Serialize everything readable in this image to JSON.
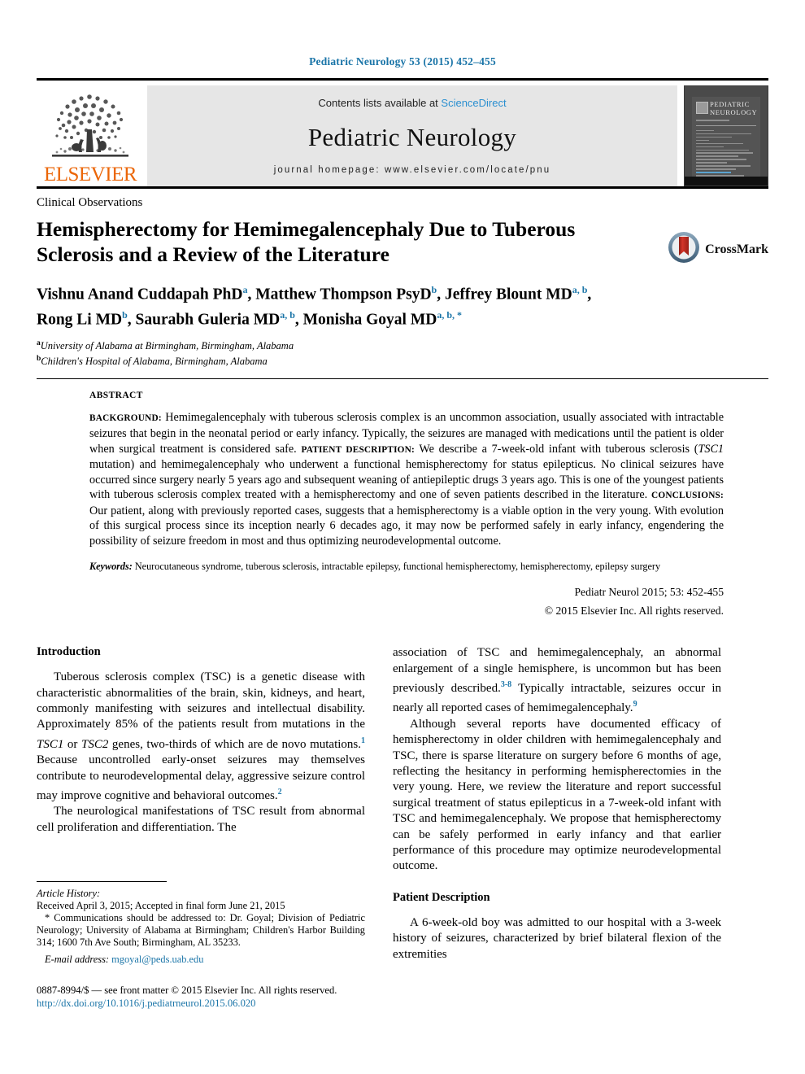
{
  "running_head": "Pediatric Neurology 53 (2015) 452–455",
  "banner": {
    "contents_prefix": "Contents lists available at ",
    "sciencedirect": "ScienceDirect",
    "journal_name": "Pediatric Neurology",
    "homepage": "journal homepage: www.elsevier.com/locate/pnu",
    "publisher_wordmark": "ELSEVIER",
    "publisher_logo_icon": "elsevier-tree-icon",
    "cover_title_line1": "PEDIATRIC",
    "cover_title_line2": "NEUROLOGY"
  },
  "article": {
    "kicker": "Clinical Observations",
    "title": "Hemispherectomy for Hemimegalencephaly Due to Tuberous Sclerosis and a Review of the Literature",
    "crossmark_label": "CrossMark",
    "crossmark_icon": "crossmark-icon",
    "authors_line1_a": "Vishnu Anand Cuddapah PhD",
    "authors_sup1": "a",
    "authors_line1_b": ", Matthew Thompson PsyD",
    "authors_sup2": "b",
    "authors_line1_c": ", Jeffrey Blount MD",
    "authors_sup3": "a, b",
    "authors_line1_d": ",",
    "authors_line2_a": "Rong Li MD",
    "authors_sup4": "b",
    "authors_line2_b": ", Saurabh Guleria MD",
    "authors_sup5": "a, b",
    "authors_line2_c": ", Monisha Goyal MD",
    "authors_sup6": "a, b, *",
    "affiliation_a_marker": "a",
    "affiliation_a": "University of Alabama at Birmingham, Birmingham, Alabama",
    "affiliation_b_marker": "b",
    "affiliation_b": "Children's Hospital of Alabama, Birmingham, Alabama"
  },
  "abstract": {
    "heading": "ABSTRACT",
    "label_background": "BACKGROUND:",
    "background_text": " Hemimegalencephaly with tuberous sclerosis complex is an uncommon association, usually associated with intractable seizures that begin in the neonatal period or early infancy. Typically, the seizures are managed with medications until the patient is older when surgical treatment is considered safe. ",
    "label_patient": "PATIENT DESCRIPTION:",
    "patient_text_pre": " We describe a 7-week-old infant with tuberous sclerosis (",
    "patient_italic": "TSC1",
    "patient_text_post": " mutation) and hemimegalencephaly who underwent a functional hemispherectomy for status epilepticus. No clinical seizures have occurred since surgery nearly 5 years ago and subsequent weaning of antiepileptic drugs 3 years ago. This is one of the youngest patients with tuberous sclerosis complex treated with a hemispherectomy and one of seven patients described in the literature. ",
    "label_conclusions": "CONCLUSIONS:",
    "conclusions_text": " Our patient, along with previously reported cases, suggests that a hemispherectomy is a viable option in the very young. With evolution of this surgical process since its inception nearly 6 decades ago, it may now be performed safely in early infancy, engendering the possibility of seizure freedom in most and thus optimizing neurodevelopmental outcome.",
    "keywords_label": "Keywords:",
    "keywords_text": " Neurocutaneous syndrome, tuberous sclerosis, intractable epilepsy, functional hemispherectomy, hemispherectomy, epilepsy surgery",
    "citation": "Pediatr Neurol 2015; 53: 452-455",
    "copyright": "© 2015 Elsevier Inc. All rights reserved."
  },
  "body": {
    "left": {
      "heading": "Introduction",
      "p1_a": "Tuberous sclerosis complex (TSC) is a genetic disease with characteristic abnormalities of the brain, skin, kidneys, and heart, commonly manifesting with seizures and intellectual disability. Approximately 85% of the patients result from mutations in the ",
      "p1_i1": "TSC1",
      "p1_b": " or ",
      "p1_i2": "TSC2",
      "p1_c": " genes, two-thirds of which are de novo mutations.",
      "p1_sup1": "1",
      "p1_d": " Because uncontrolled early-onset seizures may themselves contribute to neurodevelopmental delay, aggressive seizure control may improve cognitive and behavioral outcomes.",
      "p1_sup2": "2",
      "p2": "The neurological manifestations of TSC result from abnormal cell proliferation and differentiation. The"
    },
    "right": {
      "p1_a": "association of TSC and hemimegalencephaly, an abnormal enlargement of a single hemisphere, is uncommon but has been previously described.",
      "p1_sup1": "3-8",
      "p1_b": " Typically intractable, seizures occur in nearly all reported cases of hemimegalencephaly.",
      "p1_sup2": "9",
      "p2": "Although several reports have documented efficacy of hemispherectomy in older children with hemimegalencephaly and TSC, there is sparse literature on surgery before 6 months of age, reflecting the hesitancy in performing hemispherectomies in the very young. Here, we review the literature and report successful surgical treatment of status epilepticus in a 7-week-old infant with TSC and hemimegalencephaly. We propose that hemispherectomy can be safely performed in early infancy and that earlier performance of this procedure may optimize neurodevelopmental outcome.",
      "heading2": "Patient Description",
      "p3": "A 6-week-old boy was admitted to our hospital with a 3-week history of seizures, characterized by brief bilateral flexion of the extremities"
    }
  },
  "footnotes": {
    "history_label": "Article History:",
    "history_text": "Received April 3, 2015; Accepted in final form June 21, 2015",
    "correspondence": "* Communications should be addressed to: Dr. Goyal; Division of Pediatric Neurology; University of Alabama at Birmingham; Children's Harbor Building 314; 1600 7th Ave South; Birmingham, AL 35233.",
    "email_label": "E-mail address:",
    "email": "mgoyal@peds.uab.edu",
    "issn": "0887-8994/$ — see front matter © 2015 Elsevier Inc. All rights reserved.",
    "doi": "http://dx.doi.org/10.1016/j.pediatrneurol.2015.06.020"
  },
  "colors": {
    "link_blue": "#1b75a8",
    "sciencedirect_blue": "#2a8fd0",
    "elsevier_orange": "#EB6608",
    "banner_gray": "#e6e6e6",
    "crossmark_red": "#b5261e"
  }
}
